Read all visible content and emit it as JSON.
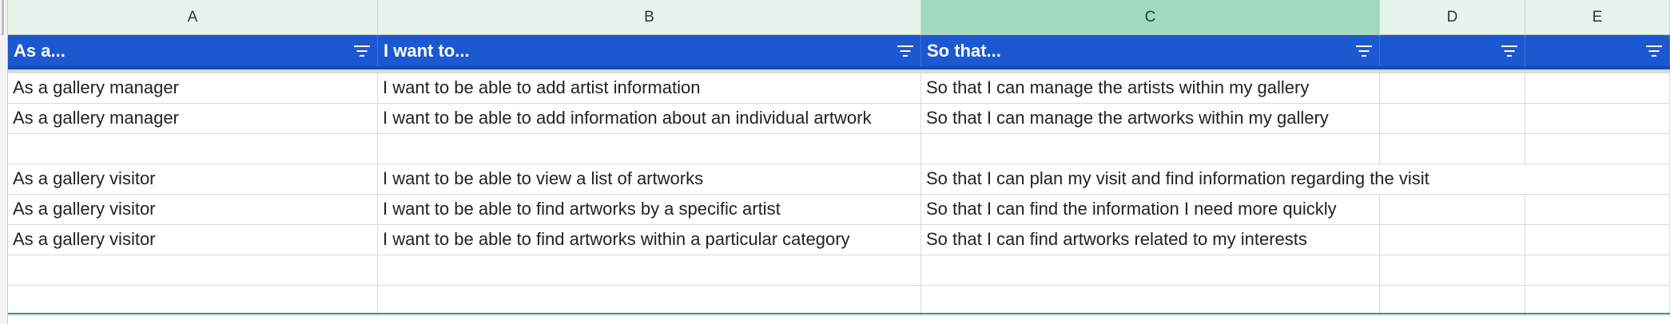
{
  "column_headers": [
    {
      "letter": "A",
      "selected": false
    },
    {
      "letter": "B",
      "selected": false
    },
    {
      "letter": "C",
      "selected": true
    },
    {
      "letter": "D",
      "selected": false
    },
    {
      "letter": "E",
      "selected": false
    }
  ],
  "header_row": [
    "As a...",
    "I want to...",
    "So that...",
    "",
    ""
  ],
  "rows": [
    [
      "As a gallery manager",
      "I want to be able to add artist information",
      "So that I can manage the artists within my gallery",
      "",
      ""
    ],
    [
      "As a gallery manager",
      "I want to be able to add information about an individual artwork",
      "So that I can manage the artworks within my gallery",
      "",
      ""
    ],
    [
      "",
      "",
      "",
      "",
      ""
    ],
    [
      "As a gallery visitor",
      "I want to be able to view a list of artworks",
      "So that I can plan my visit and find information regarding the visit",
      "",
      ""
    ],
    [
      "As a gallery visitor",
      "I want to be able to find artworks by a specific artist",
      "So that I can find the information I need more quickly",
      "",
      ""
    ],
    [
      "As a gallery visitor",
      "I want to be able to find artworks within a particular category",
      "So that I can find artworks related to my interests",
      "",
      ""
    ],
    [
      "",
      "",
      "",
      "",
      ""
    ],
    [
      "",
      "",
      "",
      "",
      ""
    ]
  ],
  "colors": {
    "header_fill": "#1c58d0",
    "column_header_fill": "#e6f4ec",
    "selected_column_fill": "#9fd9bf",
    "selection_border": "#21a366"
  },
  "icons": {
    "filter": "filter-icon"
  }
}
